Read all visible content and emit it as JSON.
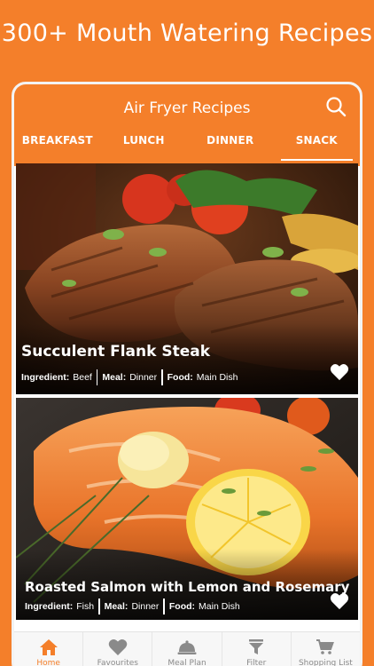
{
  "promo": {
    "headline": "300+ Mouth Watering Recipes"
  },
  "appbar": {
    "title": "Air Fryer Recipes",
    "search_icon": "search-icon"
  },
  "tabs": [
    {
      "label": "BREAKFAST"
    },
    {
      "label": "LUNCH"
    },
    {
      "label": "DINNER"
    },
    {
      "label": "SNACK",
      "active": true
    }
  ],
  "recipes": [
    {
      "title": "Succulent Flank Steak",
      "ingredient_label": "Ingredient:",
      "ingredient": "Beef",
      "meal_label": "Meal:",
      "meal": "Dinner",
      "food_label": "Food:",
      "food": "Main Dish"
    },
    {
      "title": "Roasted Salmon with Lemon and Rosemary",
      "ingredient_label": "Ingredient:",
      "ingredient": "Fish",
      "meal_label": "Meal:",
      "meal": "Dinner",
      "food_label": "Food:",
      "food": "Main Dish"
    }
  ],
  "bottom_nav": [
    {
      "label": "Home",
      "icon": "home-icon",
      "active": true
    },
    {
      "label": "Favourites",
      "icon": "heart-icon"
    },
    {
      "label": "Meal Plan",
      "icon": "cloche-icon"
    },
    {
      "label": "Filter",
      "icon": "filter-icon"
    },
    {
      "label": "Shopping List",
      "icon": "cart-icon"
    }
  ],
  "colors": {
    "accent": "#f47f2a",
    "nav_inactive": "#8a8a8a",
    "nav_bg": "#f7f7f7"
  }
}
